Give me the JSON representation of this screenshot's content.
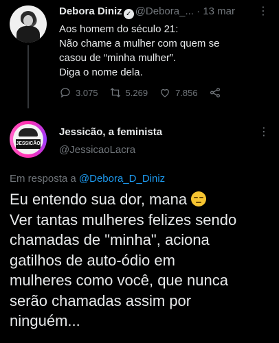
{
  "tweet": {
    "author": "Debora Diniz",
    "handle": "@Debora_...",
    "separator": "·",
    "date": "13 mar",
    "more": "⋮",
    "lines": [
      "Aos homem do século 21:",
      "Não chame a mulher com quem se",
      "casou de “minha mulher”.",
      "Diga o nome dela."
    ],
    "replies": "3.075",
    "retweets": "5.269",
    "likes": "7.856"
  },
  "reply": {
    "author": "Jessicão, a feminista",
    "handle": "@JessicaoLacra",
    "avatar_text": "JESSICÃO",
    "more": "⋮",
    "in_reply_prefix": "Em resposta a",
    "in_reply_handle": "@Debora_D_Diniz",
    "lines": [
      "Eu entendo sua dor, mana",
      "Ver tantas mulheres felizes sendo",
      "chamadas de \"minha\", aciona",
      "gatilhos de auto-ódio em",
      "mulheres como você, que nunca",
      "serão chamadas assim por",
      "ninguém..."
    ],
    "emoji": "pensive-face"
  },
  "colors": {
    "background": "#000000",
    "text": "#e7e9ea",
    "muted": "#71767b",
    "link": "#1d9bf0"
  }
}
